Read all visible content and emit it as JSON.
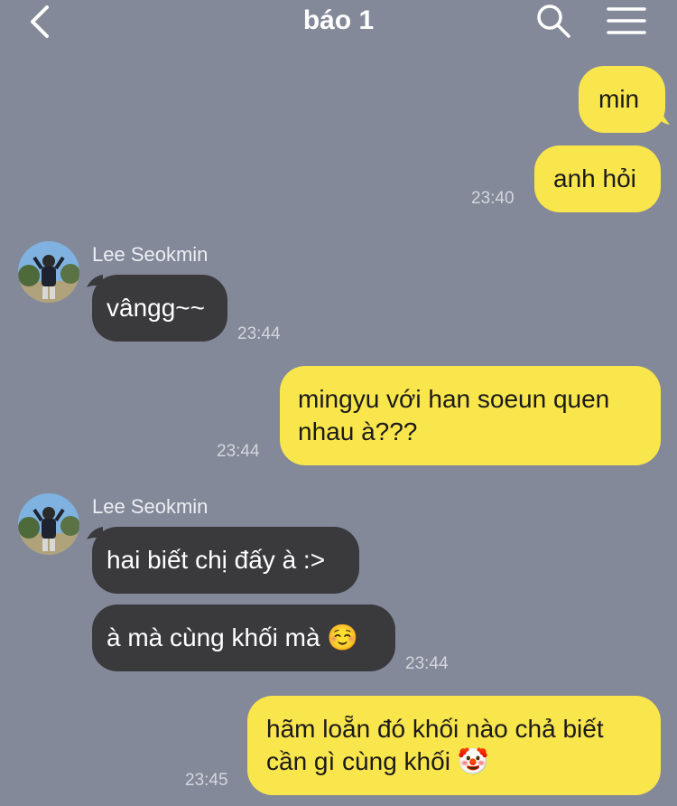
{
  "header": {
    "title": "báo 1",
    "back_icon": "chevron-left-icon",
    "search_icon": "search-icon",
    "menu_icon": "hamburger-menu-icon"
  },
  "colors": {
    "background": "#838999",
    "outgoing_bubble": "#f9e54c",
    "incoming_bubble": "#3a3a3d"
  },
  "messages": [
    {
      "sender": "me",
      "text": "min"
    },
    {
      "sender": "me",
      "text": "anh hỏi",
      "time": "23:40"
    },
    {
      "sender": "Lee Seokmin",
      "name": "Lee Seokmin",
      "text": "vângg~~",
      "time": "23:44"
    },
    {
      "sender": "me",
      "text_lines": [
        "mingyu với han soeun quen",
        "nhau à???"
      ],
      "time": "23:44"
    },
    {
      "sender": "Lee Seokmin",
      "name": "Lee Seokmin",
      "text": "hai biết chị đấy à :>"
    },
    {
      "sender": "Lee Seokmin",
      "text": "à mà cùng khối mà ☺️",
      "time": "23:44"
    },
    {
      "sender": "me",
      "text_lines": [
        "hãm loẵn đó khối nào chả biết",
        "cần gì cùng khối 🤡"
      ],
      "time": "23:45"
    }
  ]
}
